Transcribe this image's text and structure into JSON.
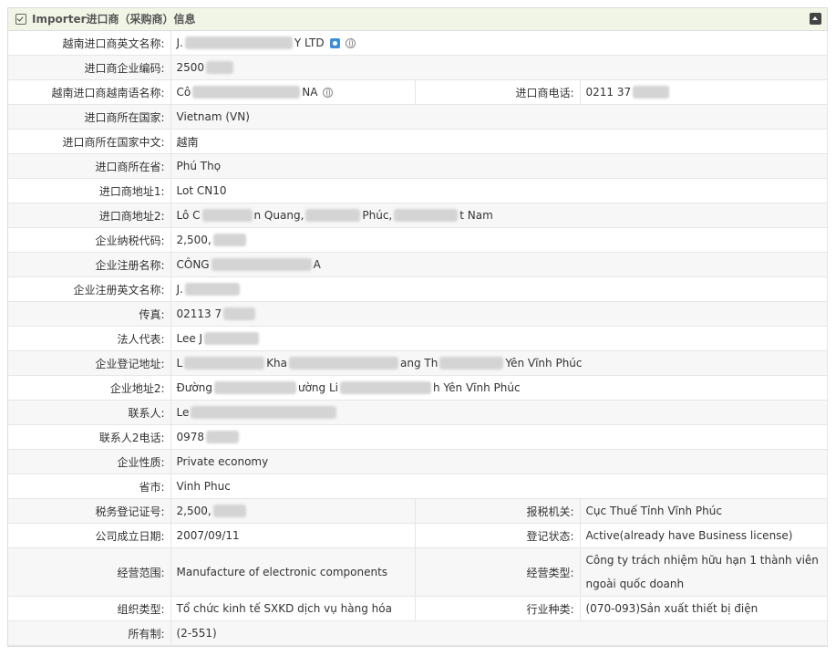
{
  "panel": {
    "title": "Importer进口商（采购商）信息"
  },
  "rows": [
    {
      "label": "越南进口商英文名称:",
      "pre": "J.",
      "post": "Y LTD"
    },
    {
      "label": "进口商企业编码:",
      "pre": "2500"
    },
    {
      "label": "越南进口商越南语名称:",
      "pre": "Cô",
      "post": "NA",
      "label2": "进口商电话:",
      "value2": "0211 37"
    },
    {
      "label": "进口商所在国家:",
      "value": "Vietnam (VN)"
    },
    {
      "label": "进口商所在国家中文:",
      "value": "越南"
    },
    {
      "label": "进口商所在省:",
      "value": "Phú Thọ"
    },
    {
      "label": "进口商地址1:",
      "value": "Lot CN10"
    },
    {
      "label": "进口商地址2:",
      "p1": "Lô C",
      "p2": "n Quang,",
      "p3": "Phúc,",
      "p4": "t Nam"
    },
    {
      "label": "企业纳税代码:",
      "pre": "2,500,"
    },
    {
      "label": "企业注册名称:",
      "pre": "CÔNG",
      "post": "A"
    },
    {
      "label": "企业注册英文名称:",
      "pre": "J."
    },
    {
      "label": "传真:",
      "pre": "02113 7"
    },
    {
      "label": "法人代表:",
      "pre": "Lee J"
    },
    {
      "label": "企业登记地址:",
      "p1": "L",
      "p2": "Kha",
      "p3": "ang Th",
      "p4": "Yên Vĩnh Phúc"
    },
    {
      "label": "企业地址2:",
      "p1": "Đường",
      "p2": "ường Li",
      "p3": "h Yên Vĩnh Phúc"
    },
    {
      "label": "联系人:",
      "pre": "Le"
    },
    {
      "label": "联系人2电话:",
      "pre": "0978"
    },
    {
      "label": "企业性质:",
      "value": "Private economy"
    },
    {
      "label": "省市:",
      "value": "Vinh Phuc"
    },
    {
      "label": "税务登记证号:",
      "pre": "2,500,",
      "label2": "报税机关:",
      "value2": "Cục Thuế Tỉnh Vĩnh Phúc"
    },
    {
      "label": "公司成立日期:",
      "value": "2007/09/11",
      "label2": "登记状态:",
      "value2": "Active(already have Business license)"
    },
    {
      "label": "经营范围:",
      "value": "Manufacture of electronic components",
      "label2": "经营类型:",
      "value2": "Công ty trách nhiệm hữu hạn 1 thành viên ngoài quốc doanh"
    },
    {
      "label": "组织类型:",
      "value": "Tổ chức kinh tế SXKD dịch vụ hàng hóa",
      "label2": "行业种类:",
      "value2": "(070-093)Sản xuất thiết bị điện"
    },
    {
      "label": "所有制:",
      "value": "(2-551)"
    }
  ]
}
